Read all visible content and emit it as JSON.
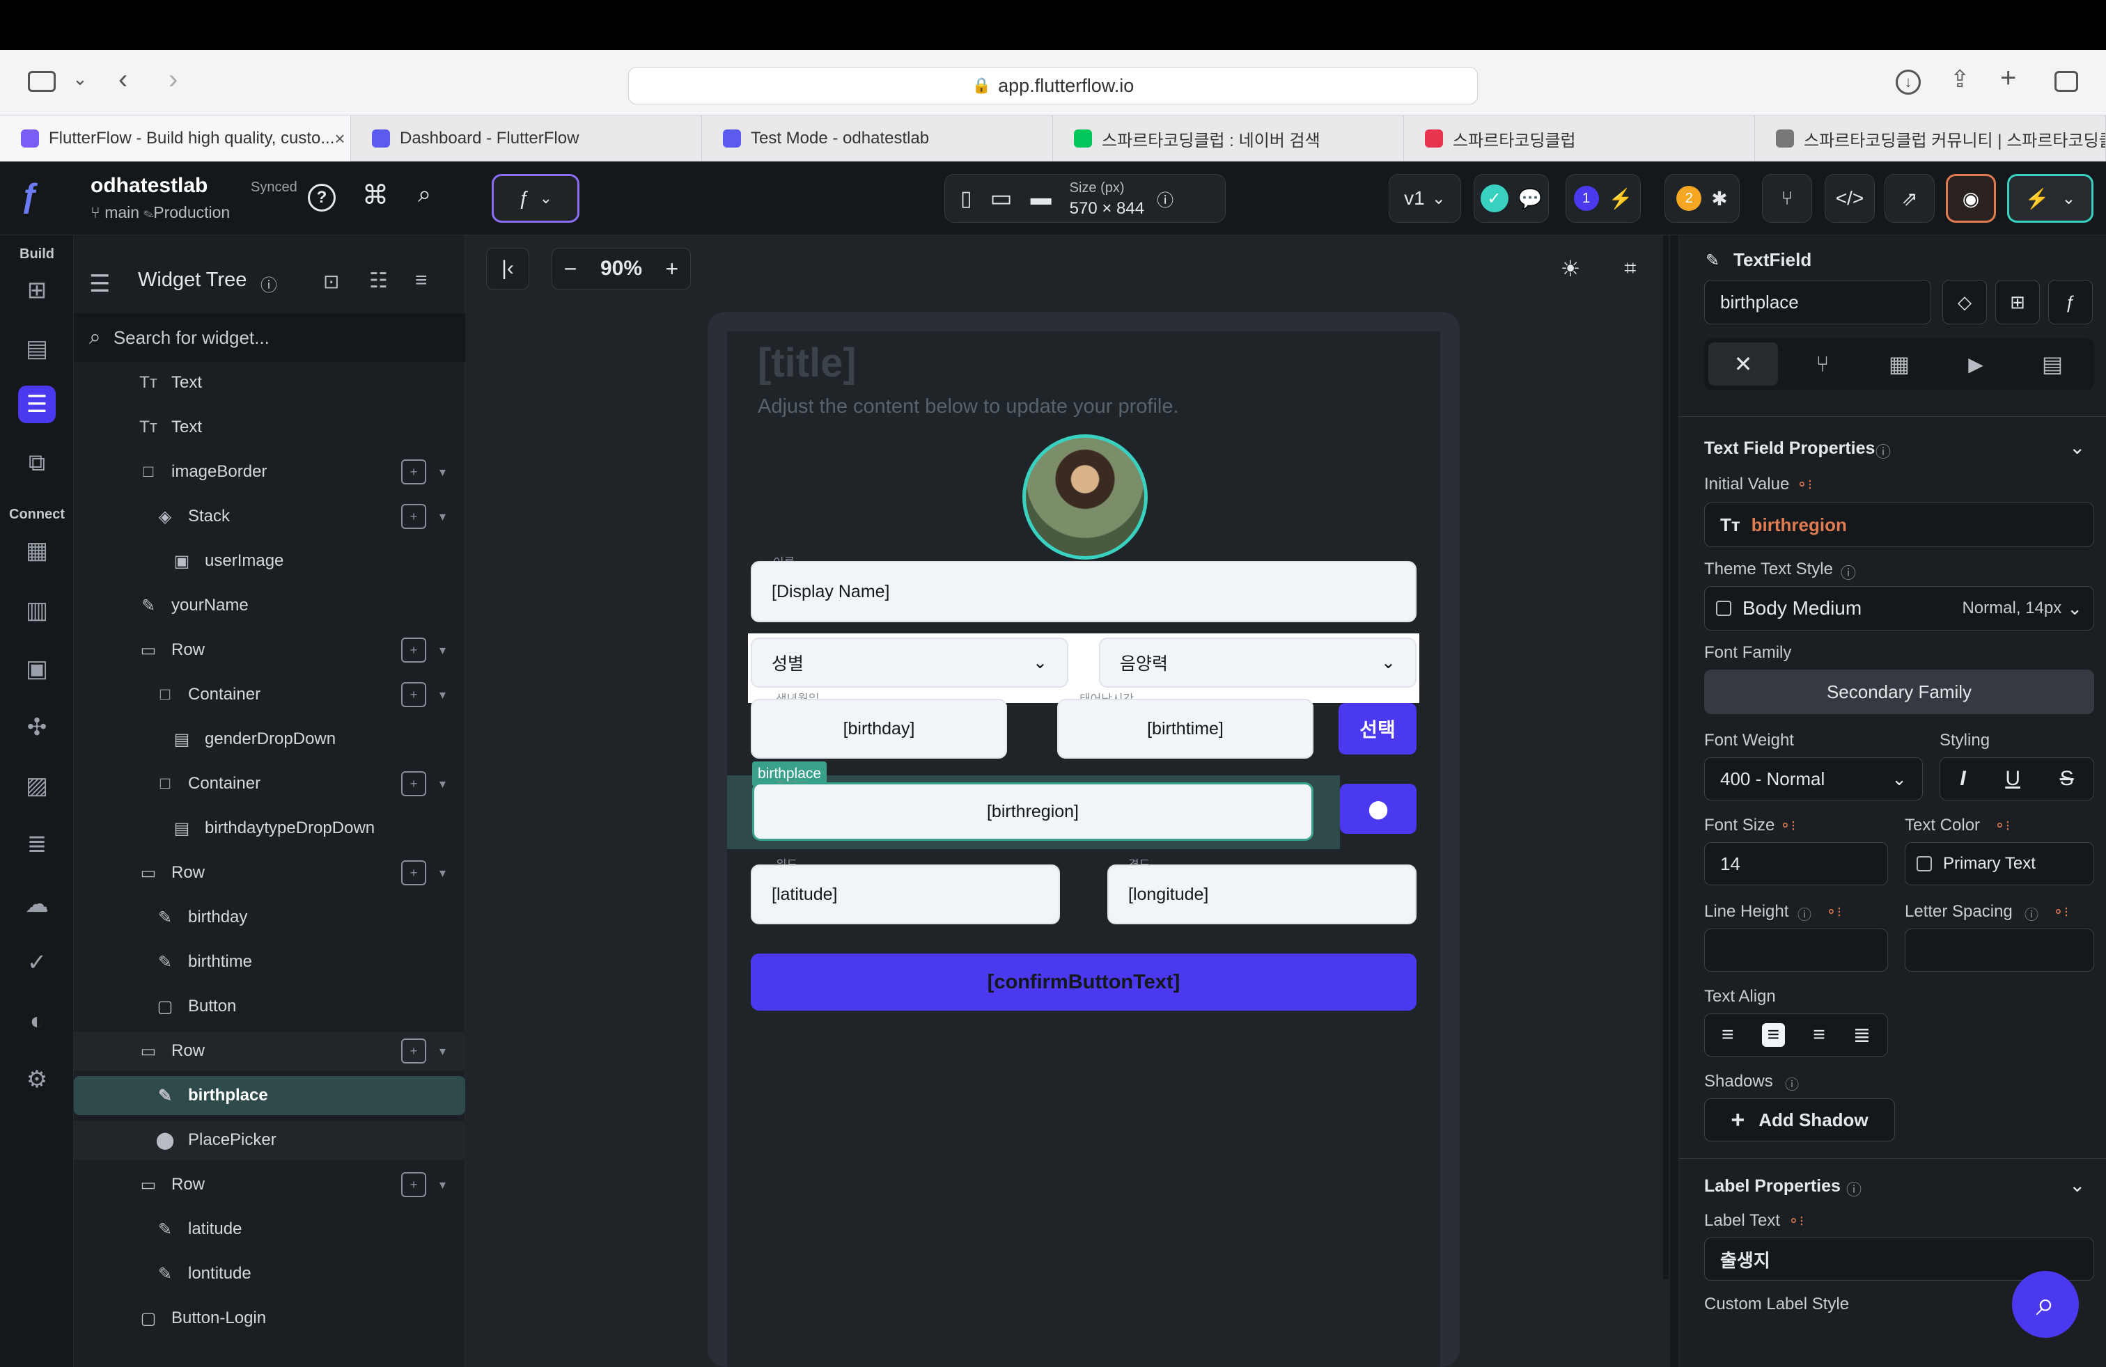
{
  "browser": {
    "url": "app.flutterflow.io",
    "tabs": [
      {
        "title": "FlutterFlow - Build high quality, custo...",
        "color": "#7b5cf5"
      },
      {
        "title": "Dashboard - FlutterFlow",
        "color": "#5b5bf0"
      },
      {
        "title": "Test Mode - odhatestlab",
        "color": "#5b5bf0"
      },
      {
        "title": "스파르타코딩클럽 : 네이버 검색",
        "color": "#03c75a"
      },
      {
        "title": "스파르타코딩클럽",
        "color": "#e8344e"
      },
      {
        "title": "스파르타코딩클럽 커뮤니티 | 스파르타코딩클...",
        "color": "#777"
      }
    ]
  },
  "header": {
    "project": "odhatestlab",
    "sync": "Synced",
    "branch": "main",
    "env": "Production",
    "size_label": "Size (px)",
    "size_value": "570 × 844",
    "version": "v1",
    "badge1": "1",
    "badge2": "2",
    "accent": "#4b39ef"
  },
  "rail": {
    "build_label": "Build",
    "connect_label": "Connect"
  },
  "tree": {
    "title": "Widget Tree",
    "search_placeholder": "Search for widget...",
    "items": [
      {
        "label": "Text",
        "icon": "Tт",
        "indent": 0
      },
      {
        "label": "Text",
        "icon": "Tт",
        "indent": 0
      },
      {
        "label": "imageBorder",
        "icon": "□",
        "indent": 0
      },
      {
        "label": "Stack",
        "icon": "◈",
        "indent": 1
      },
      {
        "label": "userImage",
        "icon": "▣",
        "indent": 2
      },
      {
        "label": "yourName",
        "icon": "✎",
        "indent": 0
      },
      {
        "label": "Row",
        "icon": "▭",
        "indent": 0
      },
      {
        "label": "Container",
        "icon": "□",
        "indent": 1
      },
      {
        "label": "genderDropDown",
        "icon": "▤",
        "indent": 2
      },
      {
        "label": "Container",
        "icon": "□",
        "indent": 1
      },
      {
        "label": "birthdaytypeDropDown",
        "icon": "▤",
        "indent": 2
      },
      {
        "label": "Row",
        "icon": "▭",
        "indent": 0
      },
      {
        "label": "birthday",
        "icon": "✎",
        "indent": 1
      },
      {
        "label": "birthtime",
        "icon": "✎",
        "indent": 1
      },
      {
        "label": "Button",
        "icon": "▢",
        "indent": 1
      },
      {
        "label": "Row",
        "icon": "▭",
        "indent": 0
      },
      {
        "label": "birthplace",
        "icon": "✎",
        "indent": 1
      },
      {
        "label": "PlacePicker",
        "icon": "⬤",
        "indent": 1
      },
      {
        "label": "Row",
        "icon": "▭",
        "indent": 0
      },
      {
        "label": "latitude",
        "icon": "✎",
        "indent": 1
      },
      {
        "label": "lontitude",
        "icon": "✎",
        "indent": 1
      },
      {
        "label": "Button-Login",
        "icon": "▢",
        "indent": 0
      }
    ]
  },
  "canvas": {
    "zoom": "90%",
    "title": "[title]",
    "subtitle": "Adjust the content below to update your profile.",
    "name_label": "이름",
    "name_value": "[Display Name]",
    "gender": "성별",
    "calendar": "음양력",
    "birthday_label": "생년월일",
    "birthday": "[birthday]",
    "birthtime_label": "태어난시간",
    "birthtime": "[birthtime]",
    "select_btn": "선택",
    "selected_tag": "birthplace",
    "birthplace_label": "출생지",
    "birthplace": "[birthregion]",
    "lat_label": "위도",
    "lat": "[latitude]",
    "lng_label": "경도",
    "lng": "[longitude]",
    "confirm": "[confirmButtonText]"
  },
  "props": {
    "widget_type": "TextField",
    "widget_name": "birthplace",
    "section": "Text Field Properties",
    "initial_value_label": "Initial Value",
    "initial_value": "birthregion",
    "theme_style_label": "Theme Text Style",
    "theme_style": "Body Medium",
    "theme_style_meta": "Normal, 14px",
    "font_family_label": "Font Family",
    "font_family": "Secondary Family",
    "font_weight_label": "Font Weight",
    "font_weight": "400 - Normal",
    "styling_label": "Styling",
    "font_size_label": "Font Size",
    "font_size": "14",
    "text_color_label": "Text Color",
    "text_color": "Primary Text",
    "line_height_label": "Line Height",
    "letter_spacing_label": "Letter Spacing",
    "text_align_label": "Text Align",
    "shadows_label": "Shadows",
    "add_shadow": "Add Shadow",
    "label_section": "Label Properties",
    "label_text_label": "Label Text",
    "label_text": "출생지",
    "custom_label_style": "Custom Label Style"
  }
}
